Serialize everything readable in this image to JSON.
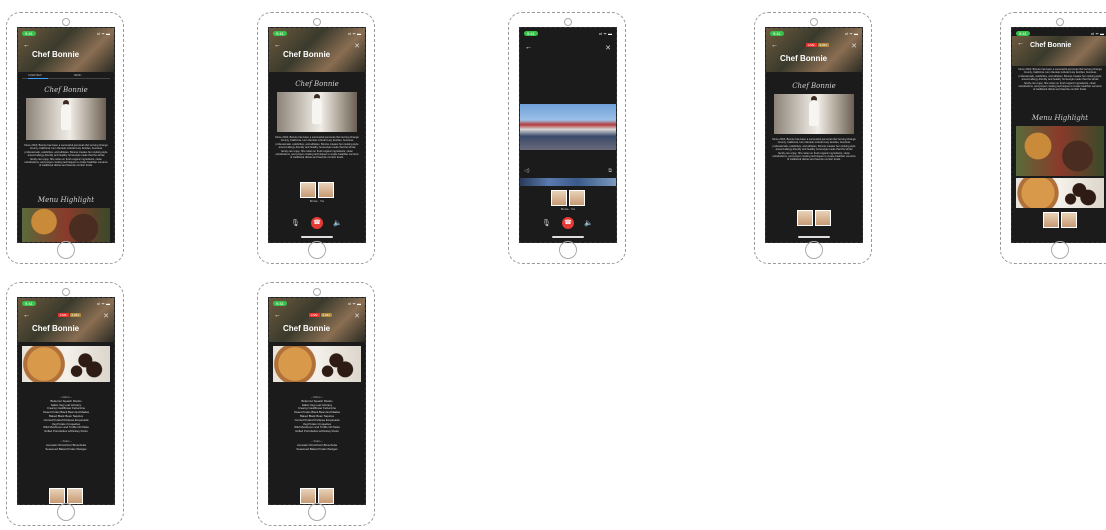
{
  "status": {
    "time": "9:41",
    "signal": "ııl ᯤ ▬"
  },
  "chef_title": "Chef Bonnie",
  "script_title": "Chef Bonnie",
  "menu_highlight": "Menu Highlight",
  "live_badge": "LIVE",
  "count_badge": "2,341",
  "tabs": {
    "a": "OVERVIEW",
    "b": "MENU"
  },
  "bio": "Since 2010, Bonnie has been a successful personal chef serving Orange County, California. Her clientele include busy families, business professionals, celebrities, and athletes. Bonnie creates her cooking style around allergy-friendly and healthy homestyle meals that the whole family can enjoy. She relies on fresh organic ingredients, clean substitutions, and proper cooking techniques to create healthier versions of traditional dishes and favorite comfort foods.",
  "menu": {
    "mains_header": "~ Mains ~",
    "mains": [
      "Butternut Squash Risotto",
      "Italian Veg Loaf w/Gravy",
      "Creamy Cauliflower Fettuccine",
      "Sweet Potato Black Bean Enchiladas",
      "Baked Black Bean Taquitos",
      "Curried Potato/Chickpea Empanada",
      "Veg Potato Croquettes",
      "Wild Mushroom and Truffle Oil Pasta",
      "Grilled Portobellos w/Parsley Pesto"
    ],
    "sides_header": "~ Sides ~",
    "sides": [
      "Avocado Chimichurri Bruschetta",
      "Seasoned Baked Potato Wedges"
    ]
  },
  "participants": {
    "a": "Bonnie",
    "b": "You"
  },
  "icons": {
    "back": "back-arrow-icon",
    "close": "close-icon",
    "mic": "microphone-icon",
    "end": "end-call-icon",
    "speaker": "speaker-icon"
  },
  "colors": {
    "end_call": "#e53935",
    "status_pill": "#3bbf4b",
    "screen_bg": "#1b1b1b"
  }
}
